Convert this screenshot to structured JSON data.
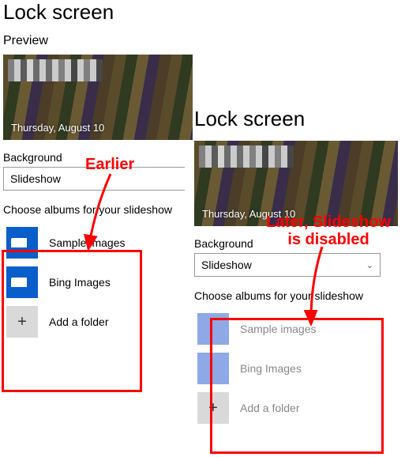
{
  "left": {
    "title": "Lock screen",
    "preview_label": "Preview",
    "date": "Thursday, August 10",
    "background_label": "Background",
    "background_value": "Slideshow",
    "albums_label": "Choose albums for your slideshow",
    "albums": [
      {
        "name": "Sample images"
      },
      {
        "name": "Bing Images"
      }
    ],
    "add_folder": "Add a folder"
  },
  "right": {
    "title": "Lock screen",
    "date": "Thursday, August 10",
    "background_label": "Background",
    "background_value": "Slideshow",
    "albums_label": "Choose albums for your slideshow",
    "albums": [
      {
        "name": "Sample images"
      },
      {
        "name": "Bing Images"
      }
    ],
    "add_folder": "Add a folder"
  },
  "annotations": {
    "earlier": "Earlier",
    "later": "Later, Slideshow is disabled"
  },
  "glyphs": {
    "plus": "+",
    "chevron": "⌄"
  }
}
